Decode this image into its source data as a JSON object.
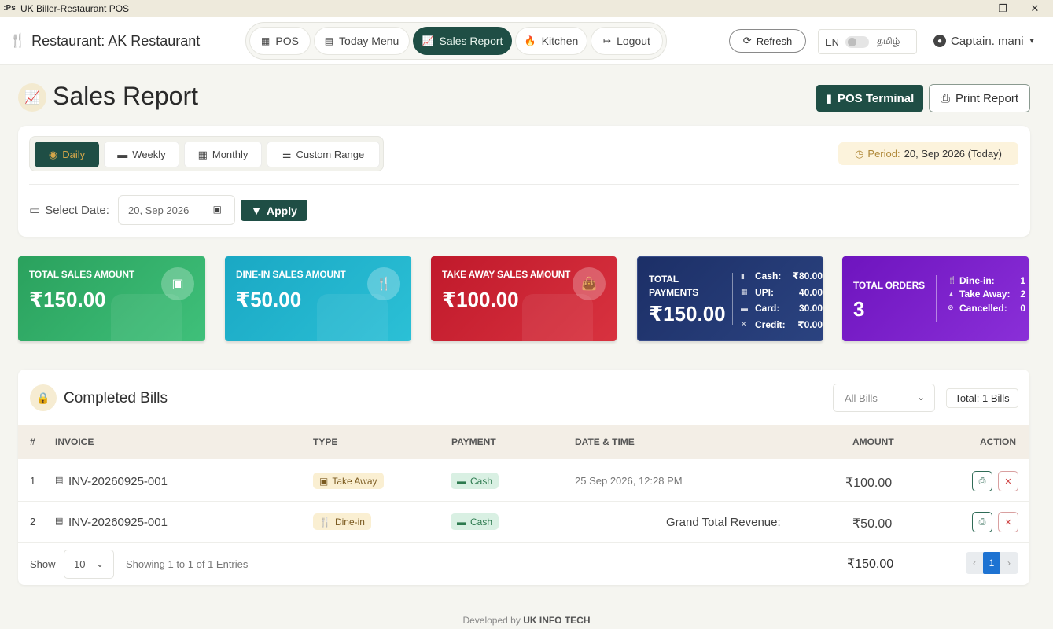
{
  "window": {
    "app_icon": ":Ps",
    "title": "UK Biller-Restaurant POS",
    "minimize": "—",
    "maximize": "❐",
    "close": "✕"
  },
  "header": {
    "brand": "Restaurant: AK Restaurant",
    "nav": [
      {
        "label": "POS",
        "icon": "pos-icon",
        "active": false
      },
      {
        "label": "Today Menu",
        "icon": "menu-icon",
        "active": false
      },
      {
        "label": "Sales Report",
        "icon": "chart-line-icon",
        "active": true
      },
      {
        "label": "Kitchen",
        "icon": "fire-icon",
        "active": false
      },
      {
        "label": "Logout",
        "icon": "logout-icon",
        "active": false
      }
    ],
    "refresh_label": "Refresh",
    "lang_en": "EN",
    "lang_ta": "தமிழ்",
    "user": "Captain. mani"
  },
  "page": {
    "title": "Sales Report",
    "pos_terminal_label": "POS Terminal",
    "print_report_label": "Print Report"
  },
  "filters": {
    "tabs": [
      {
        "label": "Daily",
        "active": true
      },
      {
        "label": "Weekly",
        "active": false
      },
      {
        "label": "Monthly",
        "active": false
      },
      {
        "label": "Custom Range",
        "active": false
      }
    ],
    "period_label": "Period:",
    "period_value": "20, Sep 2026 (Today)",
    "select_date_label": "Select Date:",
    "date_value": "20, Sep 2026",
    "apply_label": "Apply"
  },
  "stats": {
    "total_sales": {
      "label": "TOTAL SALES AMOUNT",
      "value": "₹150.00"
    },
    "dine_in": {
      "label": "DINE-IN SALES AMOUNT",
      "value": "₹50.00"
    },
    "take_away": {
      "label": "TAKE AWAY SALES AMOUNT",
      "value": "₹100.00"
    },
    "payments": {
      "label": "TOTAL PAYMENTS",
      "value": "₹150.00",
      "rows": [
        {
          "label": "Cash:",
          "amount": "₹80.00"
        },
        {
          "label": "UPI:",
          "amount": "40.00"
        },
        {
          "label": "Card:",
          "amount": "30.00"
        },
        {
          "label": "Credit:",
          "amount": "₹0.00"
        }
      ]
    },
    "orders": {
      "label": "TOTAL ORDERS",
      "value": "3",
      "rows": [
        {
          "label": "Dine-in:",
          "value": "1"
        },
        {
          "label": "Take Away:",
          "value": "2"
        },
        {
          "label": "Cancelled:",
          "value": "0"
        }
      ]
    },
    "colors": {
      "green": "#2aa15d",
      "cyan": "#1aa8c4",
      "red": "#c0192b",
      "navy": "#1c2f67",
      "purple": "#6e14be",
      "accent": "#1f4e45"
    }
  },
  "bills": {
    "title": "Completed Bills",
    "filter_value": "All Bills",
    "total_label": "Total: 1 Bills",
    "columns": {
      "num": "#",
      "invoice": "INVOICE",
      "type": "TYPE",
      "payment": "PAYMENT",
      "datetime": "DATE & TIME",
      "amount": "AMOUNT",
      "action": "ACTION"
    },
    "rows": [
      {
        "num": "1",
        "invoice": "INV-20260925-001",
        "type": "Take Away",
        "payment": "Cash",
        "datetime": "25 Sep 2026, 12:28 PM",
        "amount": "₹100.00"
      },
      {
        "num": "2",
        "invoice": "INV-20260925-001",
        "type": "Dine-in",
        "payment": "Cash",
        "datetime": "Grand Total Revenue:",
        "amount": "₹50.00"
      }
    ],
    "footer": {
      "show_label": "Show",
      "page_size": "10",
      "showing": "Showing 1 to 1 of 1 Entries",
      "grand_total": "₹150.00",
      "prev": "‹",
      "page": "1",
      "next": "›"
    }
  },
  "footer": {
    "prefix": "Developed by",
    "company": "UK INFO TECH"
  }
}
